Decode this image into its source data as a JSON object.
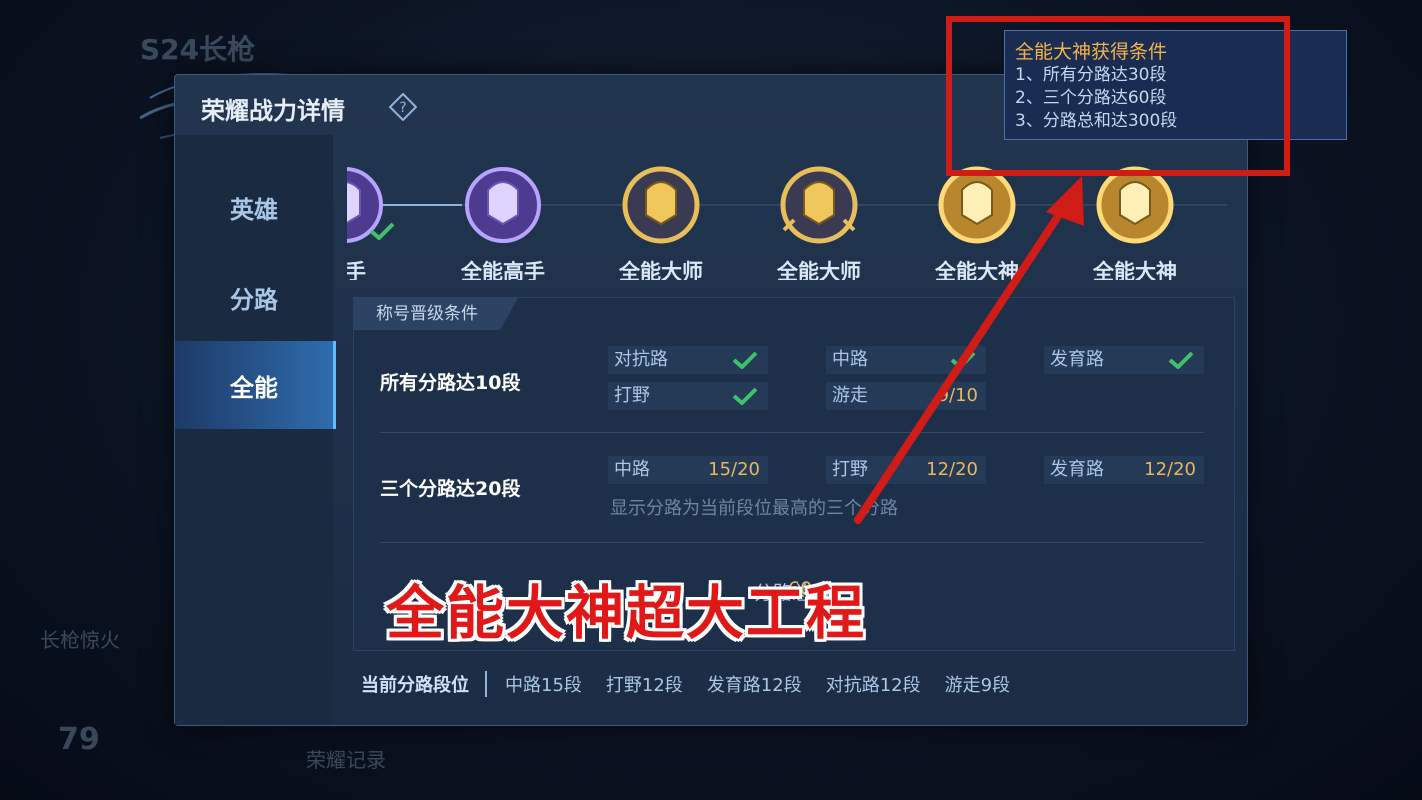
{
  "dialog": {
    "title": "荣耀战力详情",
    "sidebar": [
      "英雄",
      "分路",
      "全能"
    ],
    "badges": [
      {
        "label": "高手",
        "tier": "purple",
        "done": true
      },
      {
        "label": "全能高手",
        "tier": "purple",
        "done": false
      },
      {
        "label": "全能大师",
        "tier": "gold-dark",
        "done": false
      },
      {
        "label": "全能大师",
        "tier": "gold-dark",
        "done": false
      },
      {
        "label": "全能大神",
        "tier": "gold",
        "done": false
      },
      {
        "label": "全能大神",
        "tier": "gold",
        "done": false
      }
    ],
    "conditions_tab": "称号晋级条件",
    "row1": {
      "title": "所有分路达10段",
      "chips": [
        {
          "name": "对抗路",
          "value": "",
          "done": true
        },
        {
          "name": "中路",
          "value": "",
          "done": true
        },
        {
          "name": "发育路",
          "value": "",
          "done": true
        },
        {
          "name": "打野",
          "value": "",
          "done": true
        },
        {
          "name": "游走",
          "value": "9/10",
          "done": false
        }
      ]
    },
    "row2": {
      "title": "三个分路达20段",
      "chips": [
        {
          "name": "中路",
          "value": "15/20"
        },
        {
          "name": "打野",
          "value": "12/20"
        },
        {
          "name": "发育路",
          "value": "12/20"
        }
      ],
      "hint": "显示分路为当前段位最高的三个分路"
    },
    "row3_partial": "分路总和",
    "row3_value_partial": "60",
    "footer": {
      "label": "当前分路段位",
      "items": [
        "中路15段",
        "打野12段",
        "发育路12段",
        "对抗路12段",
        "游走9段"
      ]
    }
  },
  "tooltip": {
    "title": "全能大神获得条件",
    "lines": [
      "1、所有分路达30段",
      "2、三个分路达60段",
      "3、分路总和达300段"
    ]
  },
  "overlay_caption": "全能大神超大工程",
  "background_text": [
    "S24长枪",
    "长枪惊火",
    "荣耀记录",
    "79"
  ],
  "colors": {
    "annotation_red": "#d01b16",
    "gold": "#e8b75d",
    "check_green": "#3fc06a"
  }
}
